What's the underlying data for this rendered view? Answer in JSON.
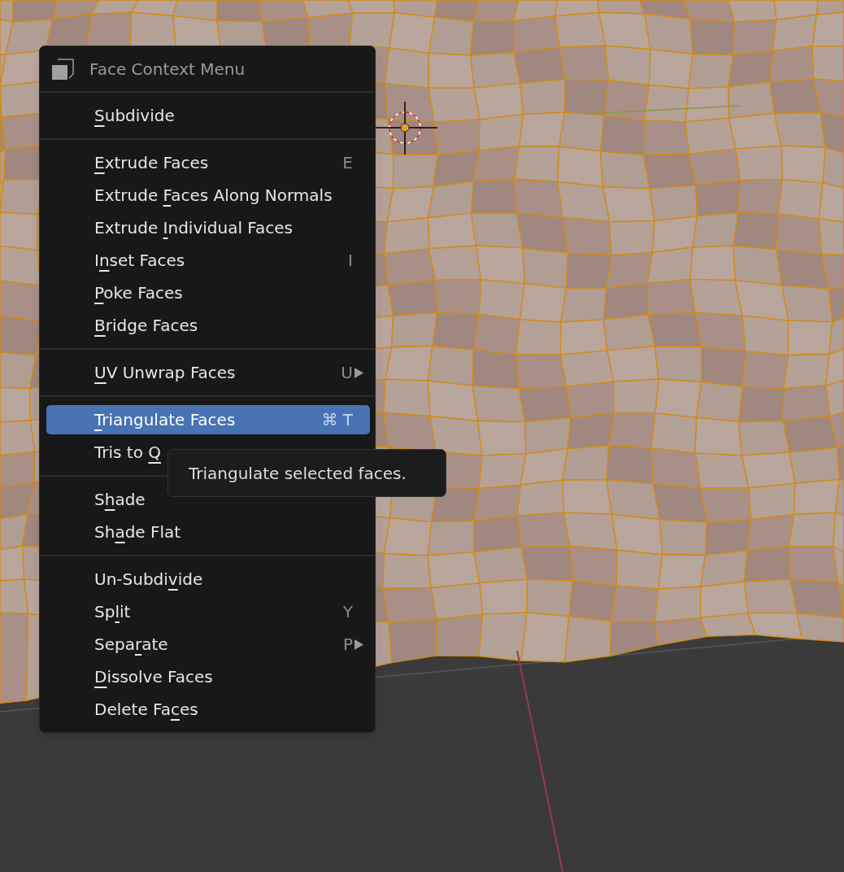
{
  "menu": {
    "title": "Face Context Menu",
    "sections": [
      {
        "items": [
          {
            "key": "S",
            "post": "ubdivide",
            "selected": false,
            "submenu": false
          }
        ]
      },
      {
        "items": [
          {
            "key": "E",
            "post": "xtrude Faces",
            "shortcut": "E",
            "selected": false,
            "submenu": false
          },
          {
            "pre": "Extrude ",
            "key": "F",
            "post": "aces Along Normals",
            "selected": false,
            "submenu": false
          },
          {
            "pre": "Extrude ",
            "key": "I",
            "post": "ndividual Faces",
            "selected": false,
            "submenu": false
          },
          {
            "pre": "I",
            "key": "n",
            "post": "set Faces",
            "shortcut": "I",
            "selected": false,
            "submenu": false
          },
          {
            "key": "P",
            "post": "oke Faces",
            "selected": false,
            "submenu": false
          },
          {
            "key": "B",
            "post": "ridge Faces",
            "selected": false,
            "submenu": false
          }
        ]
      },
      {
        "items": [
          {
            "key": "U",
            "post": "V Unwrap Faces",
            "shortcut": "U",
            "selected": false,
            "submenu": true
          }
        ]
      },
      {
        "items": [
          {
            "key": "T",
            "post": "riangulate Faces",
            "shortcut": "⌘ T",
            "selected": true,
            "submenu": false
          },
          {
            "pre": "Tris to ",
            "key": "Q",
            "selected": false,
            "submenu": false
          }
        ]
      },
      {
        "items": [
          {
            "pre": "S",
            "key": "h",
            "post": "ade",
            "selected": false,
            "submenu": false
          },
          {
            "pre": "Sh",
            "key": "a",
            "post": "de Flat",
            "selected": false,
            "submenu": false
          }
        ]
      },
      {
        "items": [
          {
            "pre": "Un-Subdi",
            "key": "v",
            "post": "ide",
            "selected": false,
            "submenu": false
          },
          {
            "pre": "Sp",
            "key": "l",
            "post": "it",
            "shortcut": "Y",
            "selected": false,
            "submenu": false
          },
          {
            "pre": "Sepa",
            "key": "r",
            "post": "ate",
            "shortcut": "P",
            "selected": false,
            "submenu": true
          },
          {
            "key": "D",
            "post": "issolve Faces",
            "selected": false,
            "submenu": false
          },
          {
            "pre": "Delete Fa",
            "key": "c",
            "post": "es",
            "selected": false,
            "submenu": false
          }
        ]
      }
    ]
  },
  "tooltip": {
    "text": "Triangulate selected faces."
  }
}
